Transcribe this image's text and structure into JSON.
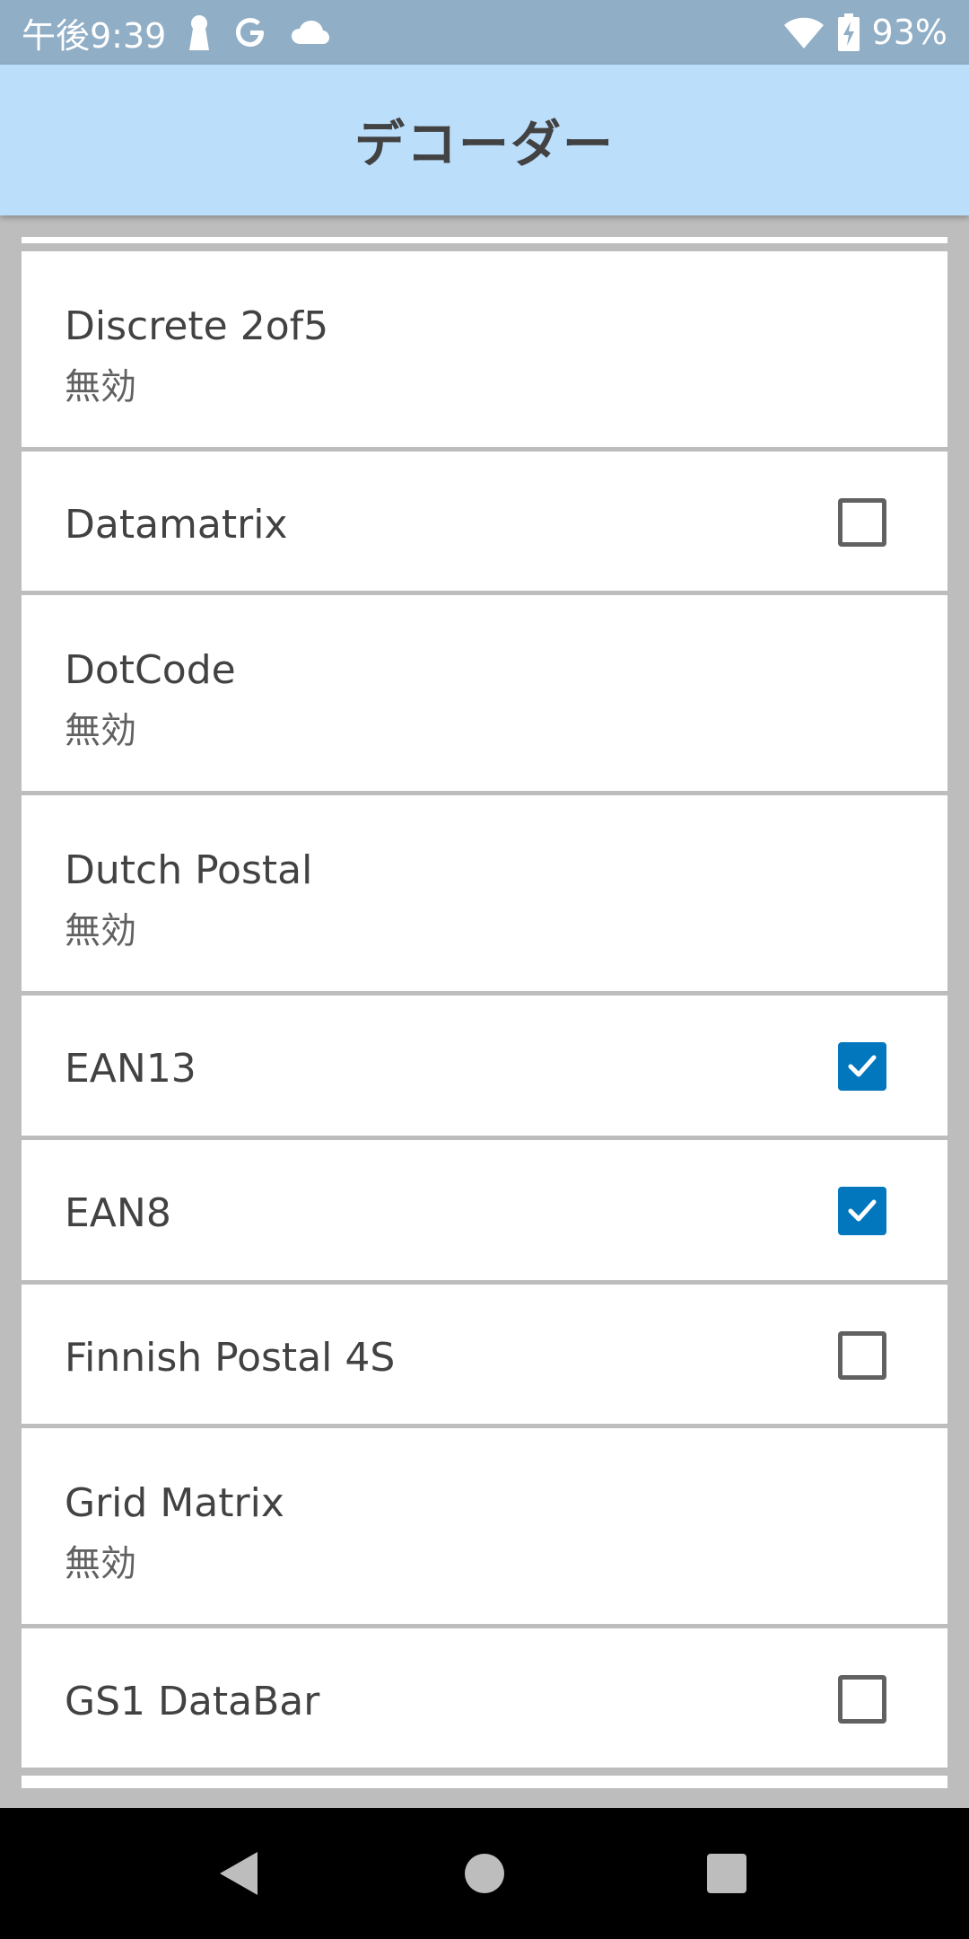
{
  "status_bar": {
    "time": "午後9:39",
    "battery_pct": "93%",
    "wifi_badge": "5",
    "icons": [
      "keyhole-icon",
      "google-icon",
      "cloud-icon",
      "wifi-icon",
      "battery-charging-icon"
    ]
  },
  "app_bar": {
    "title": "デコーダー"
  },
  "decoders": [
    {
      "title": "Discrete 2of5",
      "subtitle": "無効",
      "type": "sub"
    },
    {
      "title": "Datamatrix",
      "type": "checkbox",
      "checked": false
    },
    {
      "title": "DotCode",
      "subtitle": "無効",
      "type": "sub"
    },
    {
      "title": "Dutch Postal",
      "subtitle": "無効",
      "type": "sub"
    },
    {
      "title": "EAN13",
      "type": "checkbox",
      "checked": true
    },
    {
      "title": "EAN8",
      "type": "checkbox",
      "checked": true
    },
    {
      "title": "Finnish Postal 4S",
      "type": "checkbox",
      "checked": false
    },
    {
      "title": "Grid Matrix",
      "subtitle": "無効",
      "type": "sub"
    },
    {
      "title": "GS1 DataBar",
      "type": "checkbox",
      "checked": false
    }
  ],
  "nav_bar": {
    "buttons": [
      "back-icon",
      "home-icon",
      "recents-icon"
    ]
  },
  "colors": {
    "accent": "#0277bd",
    "app_bar": "#bbdefb",
    "status_bar": "#90aec6"
  }
}
